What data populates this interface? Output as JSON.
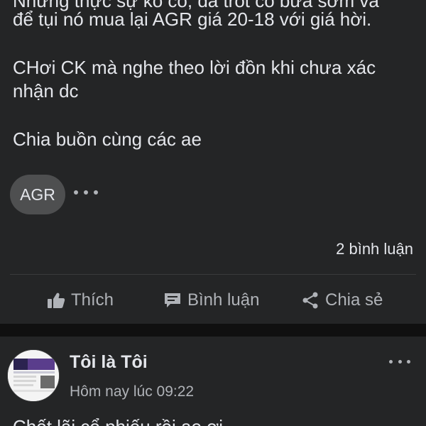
{
  "post": {
    "body_lines": [
      "Nhưng thực sự ko có, đã trót có bữa sớm và",
      "để tụi nó mua lại AGR giá 20-18 với giá hời.",
      "CHơi CK mà nghe theo lời đồn khi chưa xác",
      "nhận dc",
      "Chia buồn cùng các ae"
    ],
    "tag": "AGR",
    "comment_count": "2 bình luận",
    "actions": {
      "like": "Thích",
      "comment": "Bình luận",
      "share": "Chia sẻ"
    }
  },
  "next_post": {
    "author": "Tôi là Tôi",
    "timestamp": "Hôm nay lúc 09:22",
    "text_preview": "Chốt lãi cổ phiếu rồi ae ơi"
  },
  "colors": {
    "page_bg": "#101010",
    "card_bg": "#242526",
    "text_primary": "#e4e6eb",
    "text_secondary": "#b0b3b8",
    "chip_bg": "#4e4f50"
  },
  "icons": [
    "thumbs-up-icon",
    "comment-icon",
    "share-icon",
    "more-icon"
  ]
}
